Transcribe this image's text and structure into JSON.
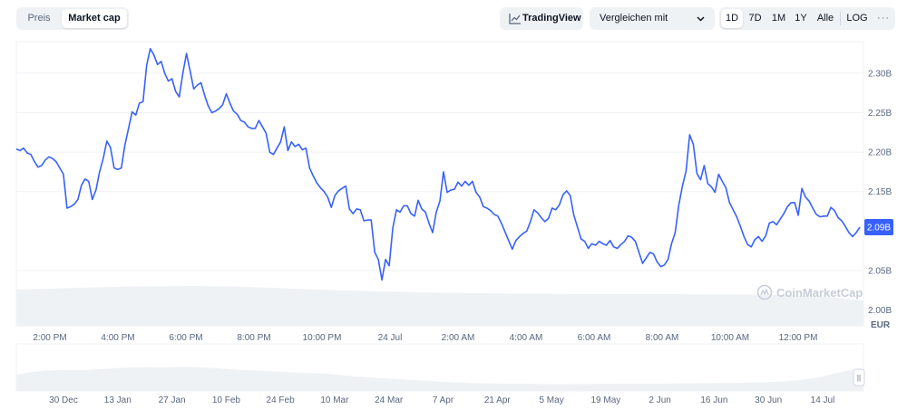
{
  "toggle": {
    "price_label": "Preis",
    "marketcap_label": "Market cap"
  },
  "tradingview_label": "TradingView",
  "compare": {
    "selected": "Vergleichen mit"
  },
  "ranges": [
    "1D",
    "7D",
    "1M",
    "1Y",
    "Alle"
  ],
  "active_range": "1D",
  "log_label": "LOG",
  "more_label": "···",
  "currency_label": "EUR",
  "watermark": "CoinMarketCap",
  "colors": {
    "line": "#3861fb",
    "grid": "#eff2f5",
    "text": "#58667e",
    "label_bg": "#3861fb"
  },
  "chart_data": {
    "type": "line",
    "ylim": [
      1.98,
      2.34
    ],
    "yticks": [
      {
        "v": 2.3,
        "label": "2.30B"
      },
      {
        "v": 2.25,
        "label": "2.25B"
      },
      {
        "v": 2.2,
        "label": "2.20B"
      },
      {
        "v": 2.15,
        "label": "2.15B"
      },
      {
        "v": 2.05,
        "label": "2.05B"
      },
      {
        "v": 2.0,
        "label": "2.00B"
      }
    ],
    "xticks": [
      "2:00 PM",
      "4:00 PM",
      "6:00 PM",
      "8:00 PM",
      "10:00 PM",
      "24 Jul",
      "2:00 AM",
      "4:00 AM",
      "6:00 AM",
      "8:00 AM",
      "10:00 AM",
      "12:00 PM"
    ],
    "current_value_label": "2.09B",
    "series": [
      {
        "values": [
          2.204,
          2.202,
          2.205,
          2.199,
          2.197,
          2.188,
          2.181,
          2.183,
          2.19,
          2.194,
          2.192,
          2.188,
          2.18,
          2.172,
          2.129,
          2.131,
          2.134,
          2.14,
          2.158,
          2.166,
          2.163,
          2.14,
          2.152,
          2.175,
          2.192,
          2.214,
          2.206,
          2.18,
          2.178,
          2.18,
          2.209,
          2.23,
          2.251,
          2.247,
          2.262,
          2.264,
          2.31,
          2.331,
          2.323,
          2.311,
          2.315,
          2.3,
          2.29,
          2.293,
          2.277,
          2.27,
          2.3,
          2.325,
          2.303,
          2.28,
          2.285,
          2.288,
          2.272,
          2.259,
          2.25,
          2.252,
          2.255,
          2.26,
          2.274,
          2.262,
          2.252,
          2.248,
          2.24,
          2.238,
          2.232,
          2.23,
          2.23,
          2.24,
          2.232,
          2.224,
          2.2,
          2.197,
          2.205,
          2.213,
          2.232,
          2.202,
          2.213,
          2.207,
          2.21,
          2.203,
          2.205,
          2.18,
          2.17,
          2.161,
          2.155,
          2.15,
          2.143,
          2.13,
          2.145,
          2.151,
          2.154,
          2.157,
          2.128,
          2.122,
          2.128,
          2.127,
          2.113,
          2.114,
          2.114,
          2.073,
          2.064,
          2.038,
          2.064,
          2.056,
          2.104,
          2.127,
          2.124,
          2.132,
          2.132,
          2.122,
          2.119,
          2.139,
          2.128,
          2.124,
          2.11,
          2.098,
          2.124,
          2.138,
          2.175,
          2.149,
          2.152,
          2.153,
          2.162,
          2.157,
          2.163,
          2.158,
          2.163,
          2.149,
          2.143,
          2.131,
          2.129,
          2.126,
          2.121,
          2.119,
          2.11,
          2.099,
          2.088,
          2.077,
          2.088,
          2.093,
          2.097,
          2.1,
          2.112,
          2.127,
          2.123,
          2.117,
          2.112,
          2.116,
          2.129,
          2.127,
          2.133,
          2.146,
          2.151,
          2.145,
          2.12,
          2.105,
          2.09,
          2.087,
          2.078,
          2.084,
          2.082,
          2.087,
          2.084,
          2.082,
          2.088,
          2.08,
          2.078,
          2.083,
          2.087,
          2.094,
          2.092,
          2.087,
          2.073,
          2.059,
          2.066,
          2.073,
          2.071,
          2.061,
          2.055,
          2.057,
          2.064,
          2.084,
          2.098,
          2.133,
          2.157,
          2.176,
          2.222,
          2.21,
          2.173,
          2.165,
          2.183,
          2.16,
          2.156,
          2.149,
          2.172,
          2.163,
          2.155,
          2.136,
          2.127,
          2.118,
          2.106,
          2.093,
          2.083,
          2.08,
          2.089,
          2.093,
          2.087,
          2.094,
          2.11,
          2.112,
          2.108,
          2.115,
          2.122,
          2.131,
          2.136,
          2.136,
          2.12,
          2.154,
          2.143,
          2.138,
          2.129,
          2.121,
          2.118,
          2.119,
          2.119,
          2.13,
          2.126,
          2.117,
          2.113,
          2.106,
          2.098,
          2.093,
          2.098,
          2.105
        ]
      }
    ]
  },
  "navigator": {
    "xticks": [
      "30 Dec",
      "13 Jan",
      "27 Jan",
      "10 Feb",
      "24 Feb",
      "10 Mar",
      "24 Mar",
      "7 Apr",
      "21 Apr",
      "5 May",
      "19 May",
      "2 Jun",
      "16 Jun",
      "30 Jun",
      "14 Jul"
    ],
    "handle_label": "||"
  }
}
